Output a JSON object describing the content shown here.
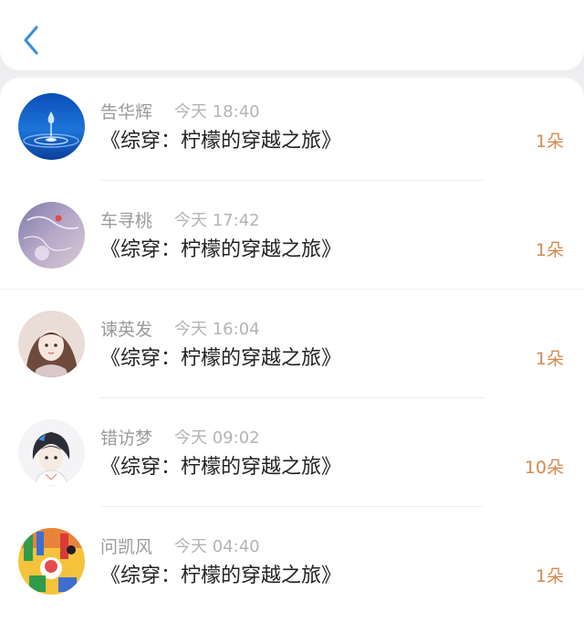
{
  "nav": {
    "back_icon": "chevron-left-icon",
    "accent_color": "#3d8fe3"
  },
  "amount_color": "#d38a4f",
  "records": [
    {
      "name": "告华辉",
      "time": "今天 18:40",
      "title": "《综穿：柠檬的穿越之旅》",
      "amount": "1朵",
      "avatar": "water-drop-avatar"
    },
    {
      "name": "车寻桃",
      "time": "今天 17:42",
      "title": "《综穿：柠檬的穿越之旅》",
      "amount": "1朵",
      "avatar": "purple-sky-avatar"
    },
    {
      "name": "谏英发",
      "time": "今天 16:04",
      "title": "《综穿：柠檬的穿越之旅》",
      "amount": "1朵",
      "avatar": "anime-girl-avatar"
    },
    {
      "name": "错访梦",
      "time": "今天 09:02",
      "title": "《综穿：柠檬的穿越之旅》",
      "amount": "10朵",
      "avatar": "anime-boy-avatar"
    },
    {
      "name": "问凯风",
      "time": "今天 04:40",
      "title": "《综穿：柠檬的穿越之旅》",
      "amount": "1朵",
      "avatar": "colorful-drawing-avatar"
    }
  ]
}
